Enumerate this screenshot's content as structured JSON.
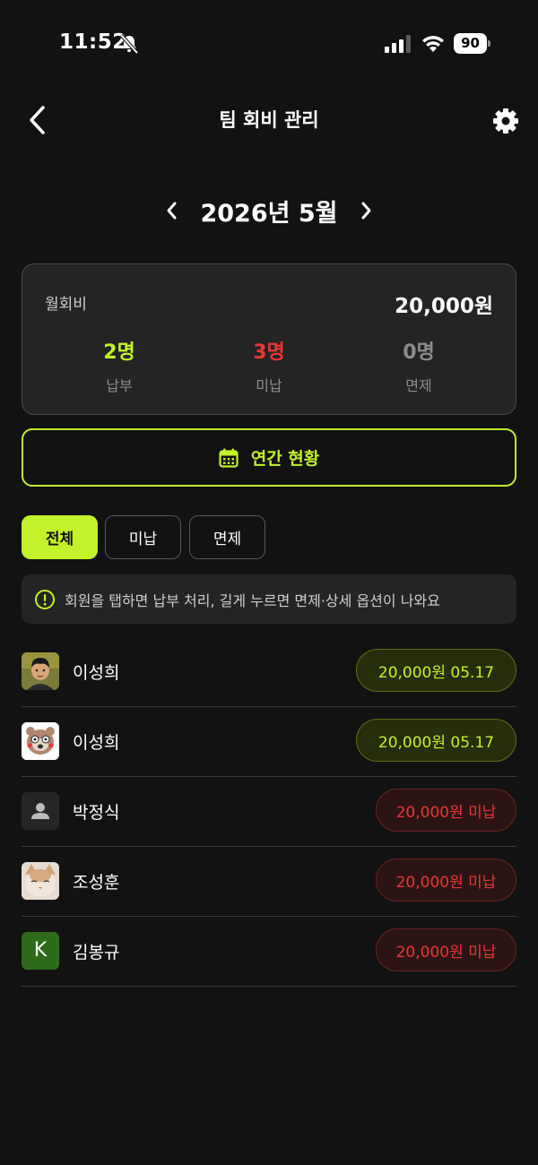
{
  "status_bar": {
    "time": "11:52",
    "battery": "90"
  },
  "header": {
    "title": "팀 회비 관리"
  },
  "month_nav": {
    "label": "2026년 5월"
  },
  "summary": {
    "fee_label": "월회비",
    "fee_value": "20,000원",
    "stats": [
      {
        "count": "2명",
        "label": "납부",
        "color": "#c2f22a"
      },
      {
        "count": "3명",
        "label": "미납",
        "color": "#e53935"
      },
      {
        "count": "0명",
        "label": "면제",
        "color": "#8c8c8c"
      }
    ]
  },
  "annual_button": {
    "label": "연간 현황"
  },
  "filters": [
    {
      "label": "전체",
      "selected": true
    },
    {
      "label": "미납",
      "selected": false
    },
    {
      "label": "면제",
      "selected": false
    }
  ],
  "hint": {
    "text": "회원을 탭하면 납부 처리, 길게 누르면 면제·상세 옵션이 나와요"
  },
  "members": [
    {
      "name": "이성희",
      "status": "paid",
      "amount_label": "20,000원  05.17",
      "avatar": "photo-boy"
    },
    {
      "name": "이성희",
      "status": "paid",
      "amount_label": "20,000원  05.17",
      "avatar": "bear-character"
    },
    {
      "name": "박정식",
      "status": "unpaid",
      "amount_label": "20,000원 미납",
      "avatar": "default-person"
    },
    {
      "name": "조성훈",
      "status": "unpaid",
      "amount_label": "20,000원 미납",
      "avatar": "photo-cat"
    },
    {
      "name": "김봉규",
      "status": "unpaid",
      "amount_label": "20,000원 미납",
      "avatar": "letter",
      "avatar_letter": "K"
    }
  ],
  "colors": {
    "accent": "#c2f22a",
    "danger": "#e53935",
    "background": "#121212"
  }
}
